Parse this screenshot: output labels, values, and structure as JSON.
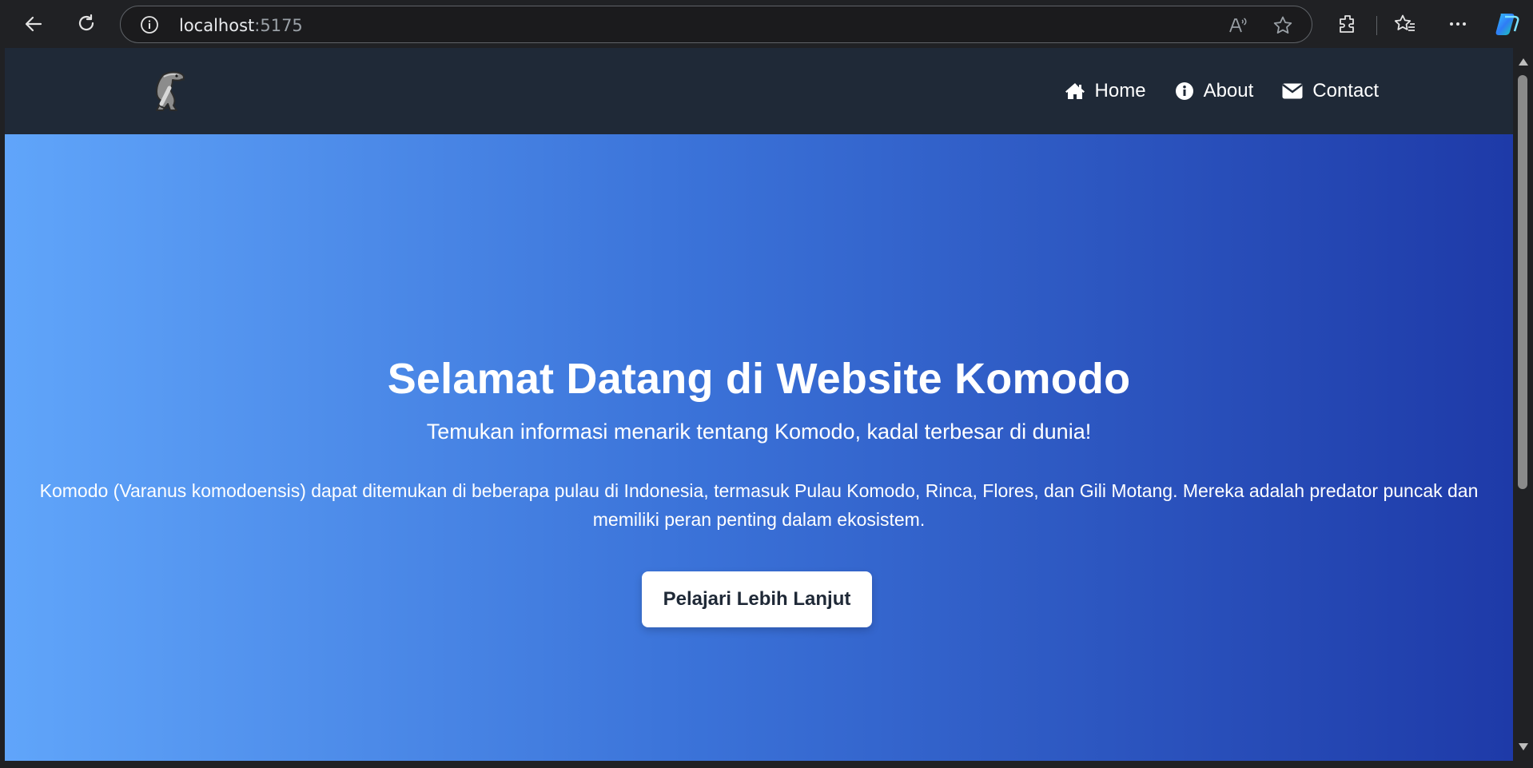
{
  "browser": {
    "url_host": "localhost",
    "url_port": ":5175",
    "icons": [
      "back-icon",
      "reload-icon",
      "site-info-icon",
      "read-aloud-icon",
      "favorite-star-icon",
      "extensions-icon",
      "favorites-icon",
      "more-icon",
      "copilot-icon"
    ]
  },
  "navbar": {
    "logo": "komodo-logo",
    "links": [
      {
        "label": "Home",
        "icon": "home-icon"
      },
      {
        "label": "About",
        "icon": "info-icon"
      },
      {
        "label": "Contact",
        "icon": "envelope-icon"
      }
    ]
  },
  "hero": {
    "title": "Selamat Datang di Website Komodo",
    "subtitle": "Temukan informasi menarik tentang Komodo, kadal terbesar di dunia!",
    "description": "Komodo (Varanus komodoensis) dapat ditemukan di beberapa pulau di Indonesia, termasuk Pulau Komodo, Rinca, Flores, dan Gili Motang. Mereka adalah predator puncak dan memiliki peran penting dalam ekosistem.",
    "cta_label": "Pelajari Lebih Lanjut"
  },
  "colors": {
    "navbar_bg": "#1f2937",
    "gradient_start": "#60a5fa",
    "gradient_end": "#1e3aa8",
    "button_bg": "#ffffff"
  }
}
